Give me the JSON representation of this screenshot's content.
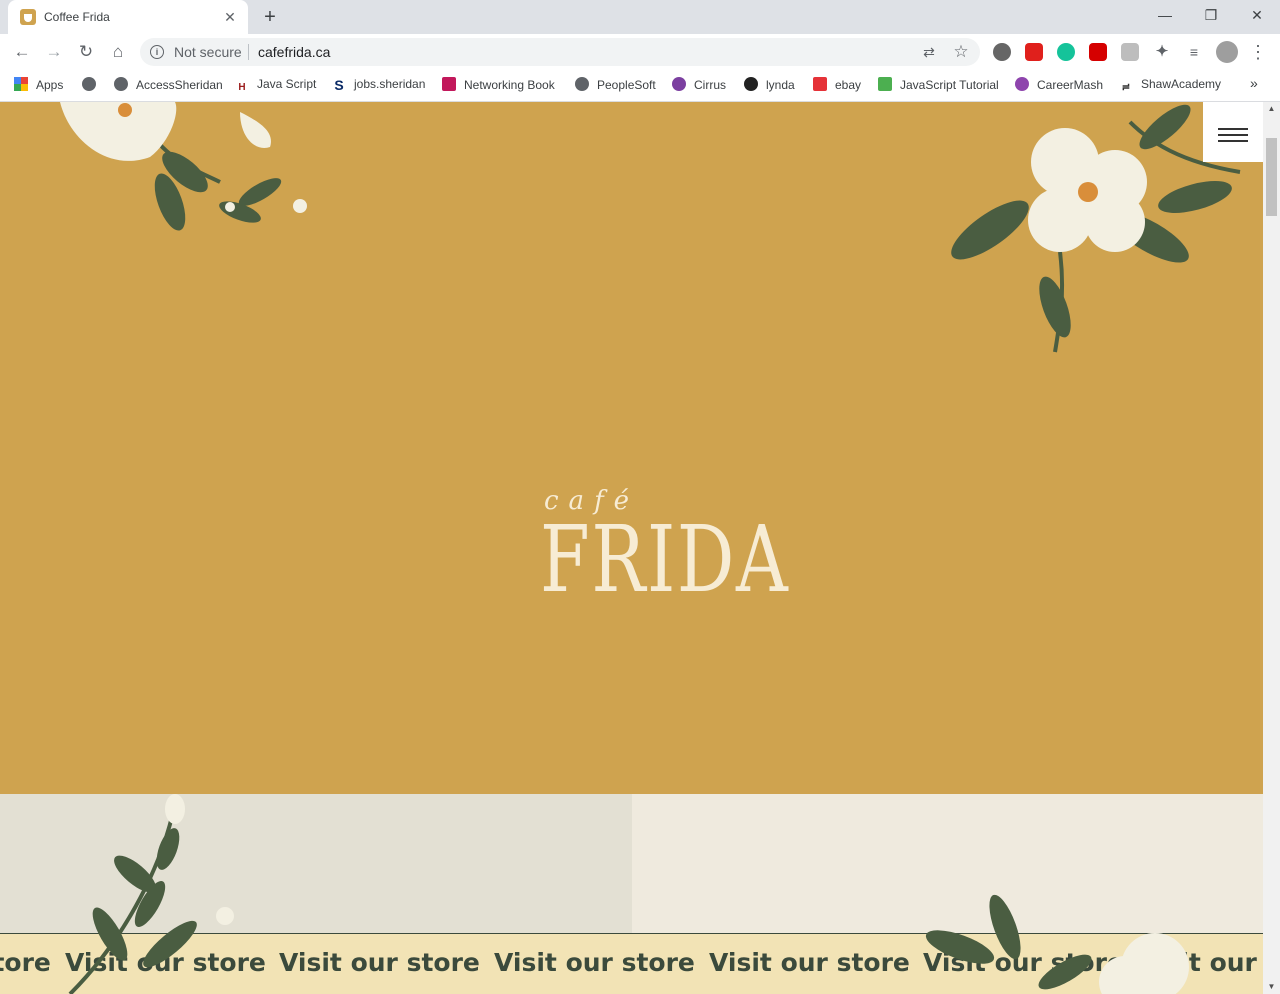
{
  "browser": {
    "tab": {
      "title": "Coffee Frida",
      "close": "✕"
    },
    "new_tab": "+",
    "window": {
      "minimize": "—",
      "restore": "❐",
      "close": "✕"
    },
    "nav": {
      "back": "←",
      "forward": "→",
      "reload": "↻",
      "home": "⌂"
    },
    "omnibox": {
      "security": "Not secure",
      "url": "cafefrida.ca",
      "info": "i",
      "translate": "⇄",
      "star": "☆"
    },
    "menu": "⋮",
    "bookmarks_overflow": "»"
  },
  "bookmarks": [
    {
      "label": "Apps",
      "icon": "apps-grid-icon",
      "color": "#ea4335"
    },
    {
      "label": "",
      "icon": "globe-icon",
      "color": "#5f6368"
    },
    {
      "label": "AccessSheridan",
      "icon": "globe-icon",
      "color": "#5f6368"
    },
    {
      "label": "Java Script",
      "icon": "hl-icon",
      "color": "#9b1c1c"
    },
    {
      "label": "jobs.sheridan",
      "icon": "s-icon",
      "color": "#0a2a66"
    },
    {
      "label": "Networking Book",
      "icon": "arrow-logo-icon",
      "color": "#c2185b"
    },
    {
      "label": "PeopleSoft",
      "icon": "globe-icon",
      "color": "#5f6368"
    },
    {
      "label": "Cirrus",
      "icon": "cirrus-icon",
      "color": "#7b3fa0"
    },
    {
      "label": "lynda",
      "icon": "lynda-icon",
      "color": "#222222"
    },
    {
      "label": "ebay",
      "icon": "ebay-bag-icon",
      "color": "#e53238"
    },
    {
      "label": "JavaScript Tutorial",
      "icon": "w3-icon",
      "color": "#4caf50"
    },
    {
      "label": "CareerMash",
      "icon": "careermash-icon",
      "color": "#8e44ad"
    },
    {
      "label": "ShawAcademy",
      "icon": "shaw-icon",
      "color": "#333333"
    }
  ],
  "site": {
    "logo_script": "café",
    "logo_name": "FRIDA",
    "ticker_text": "Visit our store",
    "colors": {
      "hero_bg": "#cfa34f",
      "logo": "#f7ecd4",
      "ticker_bg": "#f2e3b5",
      "ticker_text": "#3b4a3c",
      "leaf": "#4a5d41",
      "petal": "#f3f0e2"
    }
  },
  "ticker_items": [
    "Visit our store",
    "Visit our store",
    "Visit our store",
    "Visit our store",
    "Visit our store",
    "Visit our store",
    "Visit our store"
  ]
}
